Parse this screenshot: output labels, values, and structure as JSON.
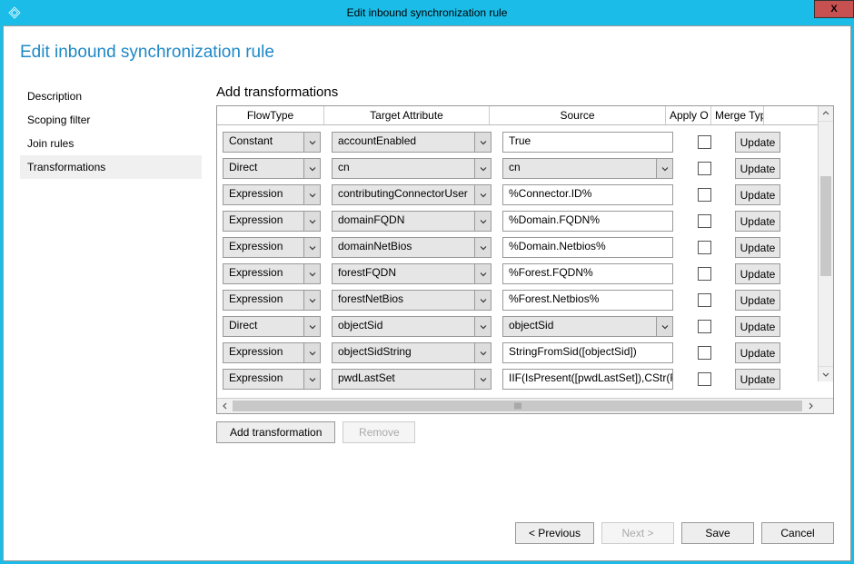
{
  "window": {
    "title": "Edit inbound synchronization rule",
    "close_glyph": "X"
  },
  "page": {
    "title": "Edit inbound synchronization rule"
  },
  "sidebar": {
    "items": [
      {
        "label": "Description",
        "selected": false
      },
      {
        "label": "Scoping filter",
        "selected": false
      },
      {
        "label": "Join rules",
        "selected": false
      },
      {
        "label": "Transformations",
        "selected": true
      }
    ]
  },
  "section_heading": "Add transformations",
  "columns": {
    "flow": "FlowType",
    "target": "Target Attribute",
    "source": "Source",
    "apply": "Apply O",
    "merge": "Merge Type"
  },
  "rows": [
    {
      "flow": "Constant",
      "target": "accountEnabled",
      "source": "True",
      "source_is_dd": false,
      "apply": false,
      "merge": "Update"
    },
    {
      "flow": "Direct",
      "target": "cn",
      "source": "cn",
      "source_is_dd": true,
      "apply": false,
      "merge": "Update"
    },
    {
      "flow": "Expression",
      "target": "contributingConnectorUser",
      "source": "%Connector.ID%",
      "source_is_dd": false,
      "apply": false,
      "merge": "Update"
    },
    {
      "flow": "Expression",
      "target": "domainFQDN",
      "source": "%Domain.FQDN%",
      "source_is_dd": false,
      "apply": false,
      "merge": "Update"
    },
    {
      "flow": "Expression",
      "target": "domainNetBios",
      "source": "%Domain.Netbios%",
      "source_is_dd": false,
      "apply": false,
      "merge": "Update"
    },
    {
      "flow": "Expression",
      "target": "forestFQDN",
      "source": "%Forest.FQDN%",
      "source_is_dd": false,
      "apply": false,
      "merge": "Update"
    },
    {
      "flow": "Expression",
      "target": "forestNetBios",
      "source": "%Forest.Netbios%",
      "source_is_dd": false,
      "apply": false,
      "merge": "Update"
    },
    {
      "flow": "Direct",
      "target": "objectSid",
      "source": "objectSid",
      "source_is_dd": true,
      "apply": false,
      "merge": "Update"
    },
    {
      "flow": "Expression",
      "target": "objectSidString",
      "source": "StringFromSid([objectSid])",
      "source_is_dd": false,
      "apply": false,
      "merge": "Update"
    },
    {
      "flow": "Expression",
      "target": "pwdLastSet",
      "source": "IIF(IsPresent([pwdLastSet]),CStr(For",
      "source_is_dd": false,
      "apply": false,
      "merge": "Update"
    }
  ],
  "actions": {
    "add": "Add transformation",
    "remove": "Remove"
  },
  "footer": {
    "previous": "< Previous",
    "next": "Next >",
    "save": "Save",
    "cancel": "Cancel"
  }
}
